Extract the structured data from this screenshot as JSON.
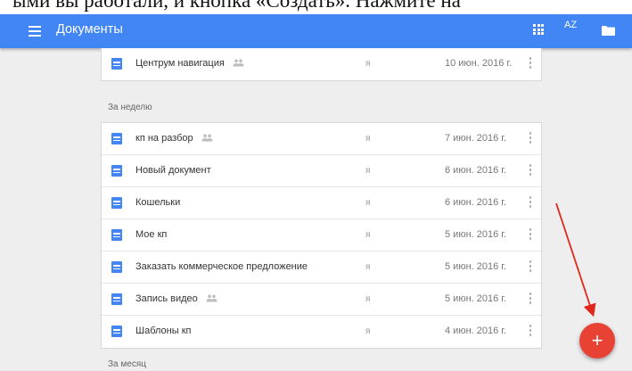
{
  "caption": {
    "text": "ыми вы работали, и кнопка «Создать». Нажмите на"
  },
  "topbar": {
    "title": "Документы",
    "color": "#4285f4",
    "icons": [
      "menu-icon",
      "grid-view-icon",
      "sort-az-icon",
      "folder-icon"
    ],
    "sort_label": "AZ"
  },
  "top_list": {
    "rows": [
      {
        "name": "Центрум навигация",
        "shared": true,
        "owner": "я",
        "date": "10 июн. 2016 г."
      }
    ]
  },
  "sections": {
    "week": "За неделю",
    "month": "За месяц"
  },
  "week_list": {
    "rows": [
      {
        "name": "кп на разбор",
        "shared": true,
        "owner": "я",
        "date": "7 июн. 2016 г."
      },
      {
        "name": "Новый документ",
        "shared": false,
        "owner": "я",
        "date": "6 июн. 2016 г."
      },
      {
        "name": "Кошельки",
        "shared": false,
        "owner": "я",
        "date": "6 июн. 2016 г."
      },
      {
        "name": "Мое кп",
        "shared": false,
        "owner": "я",
        "date": "5 июн. 2016 г."
      },
      {
        "name": "Заказать коммерческое предложение",
        "shared": false,
        "owner": "я",
        "date": "5 июн. 2016 г."
      },
      {
        "name": "Запись видео",
        "shared": true,
        "owner": "я",
        "date": "5 июн. 2016 г."
      },
      {
        "name": "Шаблоны кп",
        "shared": false,
        "owner": "я",
        "date": "4 июн. 2016 г."
      }
    ]
  },
  "fab": {
    "label": "+",
    "color": "#e84234"
  },
  "annotation": {
    "arrow_color": "#e0271b"
  }
}
